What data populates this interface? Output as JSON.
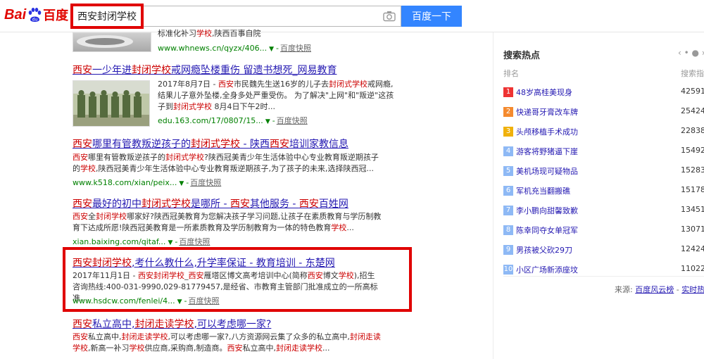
{
  "header": {
    "logo_bai": "Bai",
    "logo_du": "du",
    "logo_baidu_cn": "百度",
    "search_value": "西安封闭学校",
    "search_button": "百度一下"
  },
  "results": [
    {
      "title": "",
      "abstract": "标准化补习学校,陕西百事自院",
      "url": "www.whnews.cn/qyzx/406...",
      "snapshot": "百度快照"
    },
    {
      "title": "西安一少年进封闭学校戒网瘾坠楼重伤 留遗书想死_网易教育",
      "abstract": "2017年8月7日 - 西安市民魏先生送16岁的儿子去封闭式学校戒网瘾,结果儿子意外坠楼,全身多处严重受伤。 为了解决\"上网\"和\"叛逆\"这孩子到封闭式学校 8月4日下午2时...",
      "url": "edu.163.com/17/0807/15...",
      "snapshot": "百度快照"
    },
    {
      "title": "西安哪里有管教叛逆孩子的封闭式学校 - 陕西西安培训家教信息",
      "abstract": "西安哪里有管教叛逆孩子的封闭式学校?陕西冠美青少年生活体验中心专业教育叛逆期孩子的学校,陕西冠美青少年生活体验中心专业教育叛逆期孩子,为了孩子的未来,选择陕西冠...",
      "url": "www.k518.com/xian/peix...",
      "snapshot": "百度快照"
    },
    {
      "title": "西安最好的初中封闭式学校是哪所 - 西安其他服务 - 西安百姓网",
      "abstract": "西安全封闭学校哪家好?陕西冠美教育为您解决孩子学习问题,让孩子在素质教育与学历制教育下达成所愿!陕西冠美教育是一所素质教育及学历制教育为一体的特色教育学校...",
      "url": "xian.baixing.com/qitaf...",
      "snapshot": "百度快照"
    },
    {
      "title": "西安封闭学校,考什么教什么,升学率保证 - 教育培训 - 东楚网",
      "abstract": "2017年11月1日 - 西安封闭学校_西安雁塔区博文高考培训中心(简称西安博文学校),招生咨询热线:400-031-9990,029-81779457,是经省、市教育主管部门批准成立的一所高标准...",
      "url": "www.hsdcw.com/fenlei/4...",
      "snapshot": "百度快照"
    },
    {
      "title": "西安私立高中,封闭走读学校,可以考虑哪一家?",
      "abstract": "西安私立高中,封闭走读学校,可以考虑哪一家?,八方资源网云集了众多的私立高中,封闭走读学校,新高一补习学校供应商,采购商,制造商。西安私立高中,封闭走读学校...",
      "url": "",
      "snapshot": ""
    }
  ],
  "hot": {
    "title": "搜索热点",
    "nav": "‹ • ● ›",
    "col_rank": "排名",
    "col_index": "搜索指",
    "items": [
      {
        "rank": "1",
        "word": "48岁高桂美现身",
        "value": "42591",
        "color": "#e33"
      },
      {
        "rank": "2",
        "word": "快递哥牙膏改车牌",
        "value": "25424",
        "color": "#f48a2e"
      },
      {
        "rank": "3",
        "word": "头颅移植手术成功",
        "value": "22838",
        "color": "#f0b10b"
      },
      {
        "rank": "4",
        "word": "游客将野猪逼下崖",
        "value": "15492",
        "color": "#8eb9f5"
      },
      {
        "rank": "5",
        "word": "美机场现可疑物品",
        "value": "15283",
        "color": "#8eb9f5"
      },
      {
        "rank": "6",
        "word": "军机充当翻搬礁",
        "value": "15178",
        "color": "#8eb9f5"
      },
      {
        "rank": "7",
        "word": "李小鹏向甜馨致歉",
        "value": "13451",
        "color": "#8eb9f5"
      },
      {
        "rank": "8",
        "word": "陈幸同夺女单冠军",
        "value": "13071",
        "color": "#8eb9f5"
      },
      {
        "rank": "9",
        "word": "男孩被父砍29刀",
        "value": "12424",
        "color": "#8eb9f5"
      },
      {
        "rank": "10",
        "word": "小区广场新添座坟",
        "value": "11022",
        "color": "#8eb9f5"
      }
    ],
    "source_label": "来源:",
    "source_link": "百度风云榜",
    "realtime_link": "实时热"
  }
}
